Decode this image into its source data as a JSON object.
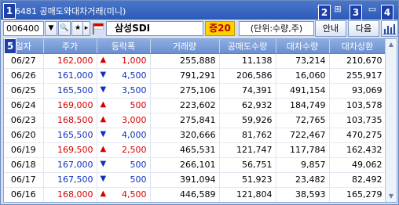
{
  "window": {
    "title": "6481 공매도와대차거래(미니)",
    "icons": [
      "pin-icon",
      "link-icon",
      "menu-icon",
      "minimize-icon"
    ]
  },
  "toolbar": {
    "code_value": "006400",
    "stock_name": "삼성SDI",
    "grade": "증20",
    "unit": "(단위:수량,주)",
    "guide_label": "안내",
    "next_label": "다음"
  },
  "markers": [
    "1",
    "2",
    "3",
    "4",
    "5"
  ],
  "table": {
    "columns": [
      "일자",
      "주가",
      "등락폭",
      "거래량",
      "공매도수량",
      "대차수량",
      "대차상환"
    ],
    "rows": [
      {
        "date": "06/27",
        "price": "162,000",
        "dir": "up",
        "change": "1,000",
        "volume": "255,888",
        "short": "11,138",
        "loan": "73,214",
        "repay": "210,670"
      },
      {
        "date": "06/26",
        "price": "161,000",
        "dir": "down",
        "change": "4,500",
        "volume": "791,291",
        "short": "206,586",
        "loan": "16,060",
        "repay": "255,917"
      },
      {
        "date": "06/25",
        "price": "165,500",
        "dir": "down",
        "change": "3,500",
        "volume": "275,106",
        "short": "74,391",
        "loan": "491,154",
        "repay": "93,069"
      },
      {
        "date": "06/24",
        "price": "169,000",
        "dir": "up",
        "change": "500",
        "volume": "223,602",
        "short": "62,932",
        "loan": "184,749",
        "repay": "103,578"
      },
      {
        "date": "06/23",
        "price": "168,500",
        "dir": "up",
        "change": "3,000",
        "volume": "275,841",
        "short": "59,926",
        "loan": "72,765",
        "repay": "103,735"
      },
      {
        "date": "06/20",
        "price": "165,500",
        "dir": "down",
        "change": "4,000",
        "volume": "320,666",
        "short": "81,762",
        "loan": "722,467",
        "repay": "470,275"
      },
      {
        "date": "06/19",
        "price": "169,500",
        "dir": "up",
        "change": "2,500",
        "volume": "465,531",
        "short": "121,747",
        "loan": "117,784",
        "repay": "162,432"
      },
      {
        "date": "06/18",
        "price": "167,000",
        "dir": "down",
        "change": "500",
        "volume": "266,101",
        "short": "56,751",
        "loan": "9,857",
        "repay": "49,062"
      },
      {
        "date": "06/17",
        "price": "167,500",
        "dir": "down",
        "change": "500",
        "volume": "391,094",
        "short": "51,923",
        "loan": "23,482",
        "repay": "82,492"
      },
      {
        "date": "06/16",
        "price": "168,000",
        "dir": "up",
        "change": "4,500",
        "volume": "446,589",
        "short": "121,804",
        "loan": "38,593",
        "repay": "165,279"
      }
    ]
  },
  "colors": {
    "up": "#d40000",
    "down": "#1030c0",
    "accent": "#2c5bb8",
    "grade_bg": "#ffd200"
  }
}
